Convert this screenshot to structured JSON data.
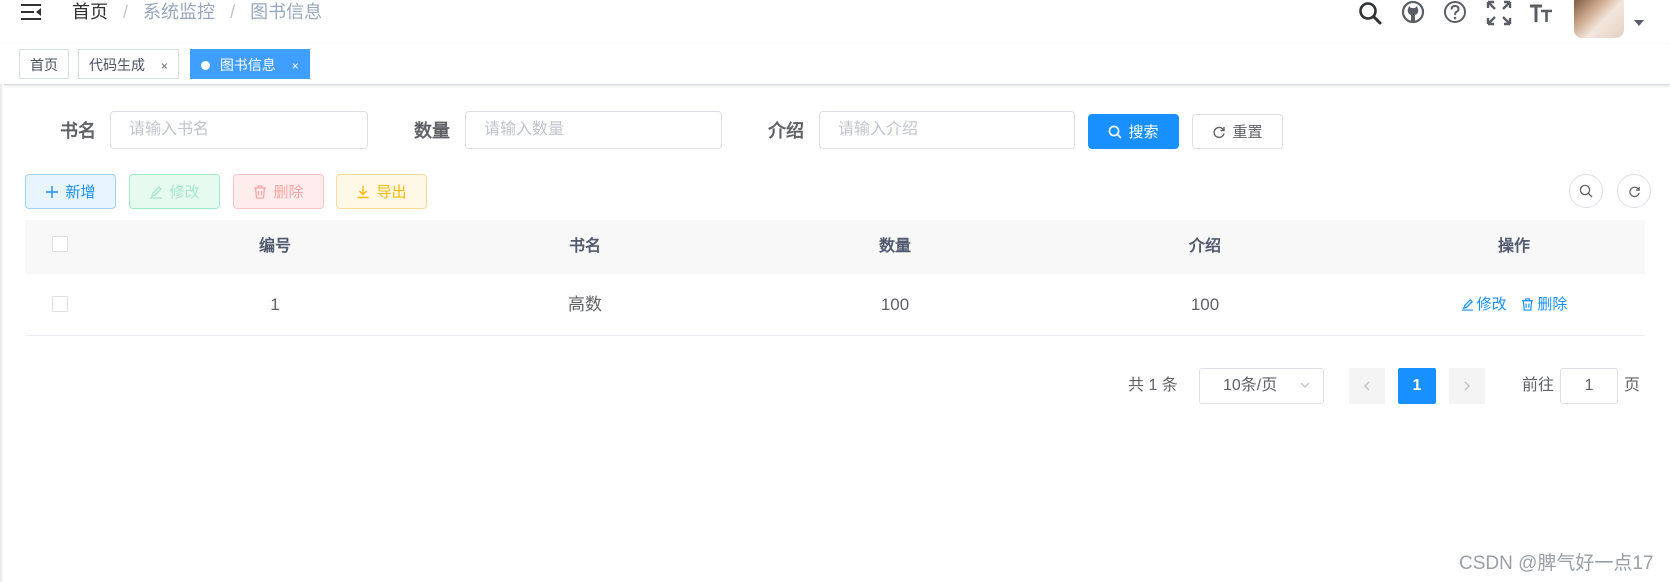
{
  "navbar": {
    "breadcrumb": [
      "首页",
      "系统监控",
      "图书信息"
    ],
    "breadcrumb_separator": "/",
    "right_icons": [
      "search-icon",
      "github-icon",
      "question-icon",
      "fullscreen-icon",
      "text-size-icon"
    ]
  },
  "tags": [
    {
      "label": "首页",
      "closable": false,
      "active": false
    },
    {
      "label": "代码生成",
      "closable": true,
      "active": false
    },
    {
      "label": "图书信息",
      "closable": true,
      "active": true
    }
  ],
  "tag_close_glyph": "×",
  "search_form": {
    "fields": [
      {
        "label": "书名",
        "placeholder": "请输入书名",
        "value": ""
      },
      {
        "label": "数量",
        "placeholder": "请输入数量",
        "value": ""
      },
      {
        "label": "介绍",
        "placeholder": "请输入介绍",
        "value": ""
      }
    ],
    "search_button": "搜索",
    "reset_button": "重置"
  },
  "toolbar": {
    "add": "新增",
    "edit": "修改",
    "delete": "删除",
    "export": "导出"
  },
  "table": {
    "columns": [
      "编号",
      "书名",
      "数量",
      "介绍",
      "操作"
    ],
    "rows": [
      {
        "id": "1",
        "name": "高数",
        "quantity": "100",
        "intro": "100",
        "edit": "修改",
        "delete": "删除"
      }
    ]
  },
  "pagination": {
    "total_text": "共 1 条",
    "page_size": "10条/页",
    "current_page": "1",
    "jump_prefix": "前往",
    "jump_value": "1",
    "jump_suffix": "页"
  },
  "watermark": "CSDN @脾气好一点17",
  "colors": {
    "primary": "#1890ff",
    "tag_active": "#409eff",
    "success_plain": "#e7faf0",
    "danger_plain": "#ffeded",
    "warning_plain": "#fff8e6"
  }
}
